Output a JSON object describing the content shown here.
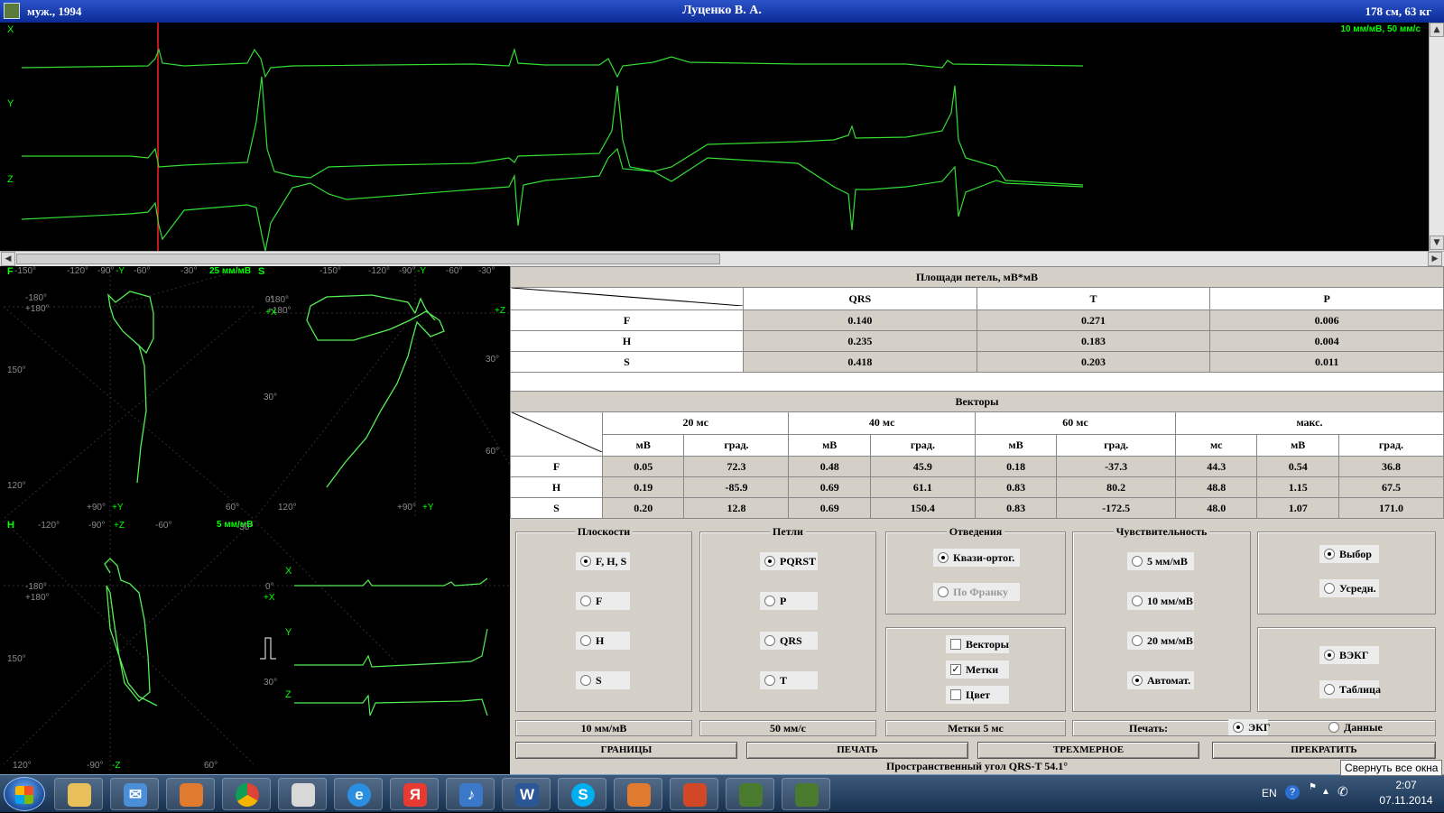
{
  "window": {
    "left": "муж., 1994",
    "title": "Луценко В. А.",
    "right": "178 см, 63 кг"
  },
  "ecg": {
    "scale_label": "10 мм/мВ, 50 мм/с",
    "leads": [
      "X",
      "Y",
      "Z"
    ]
  },
  "loops": {
    "F": {
      "label": "F",
      "scale": "25 мм/мВ"
    },
    "S": {
      "label": "S"
    },
    "H": {
      "label": "H",
      "scale": "5 мм/мВ"
    },
    "angles_top": [
      "-150°",
      "-120°",
      "-90°",
      "-Y",
      "-60°",
      "-30°"
    ],
    "angles_s_top": [
      "-150°",
      "-120°",
      "-90°",
      "-Y",
      "-60°",
      "-30°"
    ],
    "side_labels": [
      "-180°",
      "+180°",
      "0°",
      "+X",
      "+Z",
      "150°",
      "30°",
      "120°",
      "60°",
      "+90°",
      "+Y",
      "-Z",
      "+Z",
      "120°",
      "60°",
      "-120°",
      "-90°",
      "-60°",
      "-30°",
      "30°"
    ],
    "mini_leads": [
      "X",
      "Y",
      "Z"
    ]
  },
  "areas": {
    "title": "Площади петель, мВ*мВ",
    "columns": [
      "QRS",
      "T",
      "P"
    ],
    "rows": [
      {
        "name": "F",
        "values": [
          "0.140",
          "0.271",
          "0.006"
        ]
      },
      {
        "name": "H",
        "values": [
          "0.235",
          "0.183",
          "0.004"
        ]
      },
      {
        "name": "S",
        "values": [
          "0.418",
          "0.203",
          "0.011"
        ]
      }
    ]
  },
  "vectors": {
    "title": "Векторы",
    "groups": [
      "20 мс",
      "40 мс",
      "60 мс",
      "макс."
    ],
    "subcols": [
      "мВ",
      "град.",
      "мВ",
      "град.",
      "мВ",
      "град.",
      "мс",
      "мВ",
      "град."
    ],
    "rows": [
      {
        "name": "F",
        "values": [
          "0.05",
          "72.3",
          "0.48",
          "45.9",
          "0.18",
          "-37.3",
          "44.3",
          "0.54",
          "36.8"
        ]
      },
      {
        "name": "H",
        "values": [
          "0.19",
          "-85.9",
          "0.69",
          "61.1",
          "0.83",
          "80.2",
          "48.8",
          "1.15",
          "67.5"
        ]
      },
      {
        "name": "S",
        "values": [
          "0.20",
          "12.8",
          "0.69",
          "150.4",
          "0.83",
          "-172.5",
          "48.0",
          "1.07",
          "171.0"
        ]
      }
    ]
  },
  "controls": {
    "planes": {
      "title": "Плоскости",
      "options": [
        "F, H, S",
        "F",
        "H",
        "S"
      ],
      "selected": 0
    },
    "loops": {
      "title": "Петли",
      "options": [
        "PQRST",
        "P",
        "QRS",
        "T"
      ],
      "selected": 0
    },
    "leads": {
      "title": "Отведения",
      "options": [
        "Квази-ортог.",
        "По Франку"
      ],
      "selected": 0
    },
    "checks": [
      {
        "label": "Векторы",
        "checked": false
      },
      {
        "label": "Метки",
        "checked": true
      },
      {
        "label": "Цвет",
        "checked": false
      }
    ],
    "sensitivity": {
      "title": "Чувствительность",
      "options": [
        "5 мм/мВ",
        "10 мм/мВ",
        "20 мм/мВ",
        "Автомат."
      ],
      "selected": 3
    },
    "mode": {
      "options": [
        "Выбор",
        "Усредн."
      ],
      "selected": 0
    },
    "view": {
      "options": [
        "ВЭКГ",
        "Таблица"
      ],
      "selected": 0
    }
  },
  "status": {
    "sens": "10 мм/мВ",
    "speed": "50 мм/с",
    "marks": "Метки 5 мс",
    "print_label": "Печать:",
    "print_opts": [
      "ЭКГ",
      "Данные"
    ],
    "print_selected": 0
  },
  "buttons": {
    "bounds": "ГРАНИЦЫ",
    "print": "ПЕЧАТЬ",
    "three_d": "ТРЕХМЕРНОЕ",
    "stop": "ПРЕКРАТИТЬ"
  },
  "footer": "Пространственный угол QRS-T  54.1°",
  "tooltip": "Свернуть все окна",
  "tray": {
    "lang": "EN",
    "time": "2:07",
    "date": "07.11.2014"
  }
}
